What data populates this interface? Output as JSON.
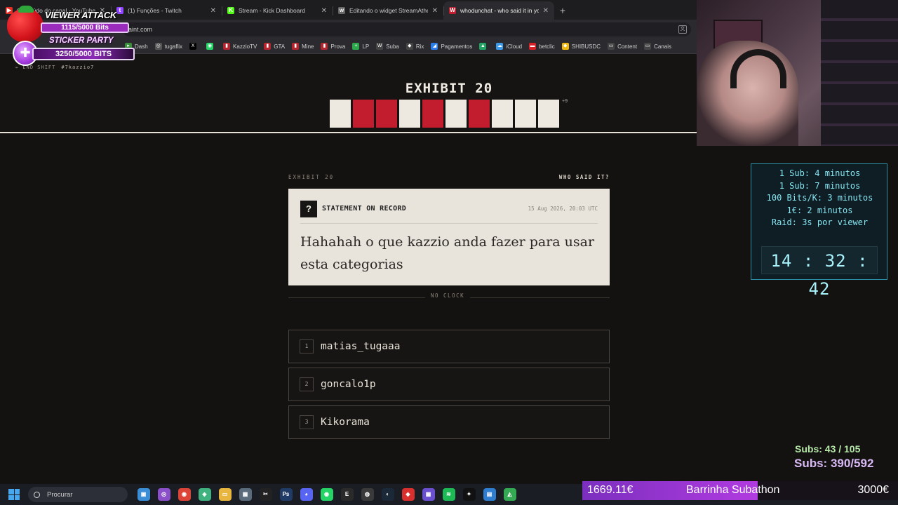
{
  "browser": {
    "tabs": [
      {
        "title": "Conteúdo do canal - YouTube Studio",
        "fav": "#e52d27",
        "glyph": "▶",
        "active": false
      },
      {
        "title": "(1) Funções - Twitch",
        "fav": "#9146ff",
        "glyph": "t",
        "active": false
      },
      {
        "title": "Stream - Kick Dashboard",
        "fav": "#53fc18",
        "glyph": "K",
        "active": false
      },
      {
        "title": "Editando o widget StreamAthon",
        "fav": "#666666",
        "glyph": "w",
        "active": false
      },
      {
        "title": "whodunchat - who said it in your chat",
        "fav": "#c21d2e",
        "glyph": "W",
        "active": true
      }
    ],
    "new_tab": "+",
    "address": "aint.com",
    "bookmarks": [
      {
        "label": "Dash",
        "color": "#3a8f3a",
        "glyph": "▸"
      },
      {
        "label": "tugaflix",
        "color": "#555555",
        "glyph": "◎"
      },
      {
        "label": "",
        "color": "#000000",
        "glyph": "X"
      },
      {
        "label": "",
        "color": "#25d366",
        "glyph": "◉"
      },
      {
        "label": "KazzioTV",
        "color": "#b3262e",
        "glyph": "▮"
      },
      {
        "label": "GTA",
        "color": "#b3262e",
        "glyph": "▮"
      },
      {
        "label": "Mine",
        "color": "#b3262e",
        "glyph": "▮"
      },
      {
        "label": "Prova",
        "color": "#b3262e",
        "glyph": "▮"
      },
      {
        "label": "LP",
        "color": "#2da84a",
        "glyph": "+"
      },
      {
        "label": "Suba",
        "color": "#444444",
        "glyph": "W"
      },
      {
        "label": "Rix",
        "color": "#444444",
        "glyph": "◆"
      },
      {
        "label": "Pagamentos",
        "color": "#2b7de9",
        "glyph": "◢"
      },
      {
        "label": "",
        "color": "#1fa463",
        "glyph": "▲"
      },
      {
        "label": "iCloud",
        "color": "#3b9be8",
        "glyph": "☁"
      },
      {
        "label": "betclic",
        "color": "#d71f26",
        "glyph": "▬"
      },
      {
        "label": "SHIBUSDC",
        "color": "#f0b90b",
        "glyph": "◆"
      },
      {
        "label": "Content",
        "color": "#444444",
        "glyph": "▭"
      },
      {
        "label": "Canais",
        "color": "#444444",
        "glyph": "▭"
      }
    ]
  },
  "page": {
    "end_shift": "← END SHIFT",
    "channel": "#7kazzio7",
    "exhibit_title": "EXHIBIT 20",
    "strip": [
      "white",
      "red",
      "red",
      "white",
      "red",
      "white",
      "red",
      "white",
      "white",
      "white"
    ],
    "strip_more": "+9",
    "label_left": "EXHIBIT 20",
    "label_right": "WHO SAID IT?",
    "statement_label": "STATEMENT ON RECORD",
    "statement_time": "15 Aug 2026, 20:03 UTC",
    "quote": "Hahahah o que kazzio anda fazer para usar esta categorias",
    "no_clock": "NO CLOCK",
    "options": [
      {
        "num": "1",
        "name": "matias_tugaaa"
      },
      {
        "num": "2",
        "name": "goncalo1p"
      },
      {
        "num": "3",
        "name": "Kikorama"
      }
    ]
  },
  "overlay": {
    "viewer_attack": "VIEWER ATTACK",
    "bits1": "1115/5000 Bits",
    "sticker_party": "STICKER PARTY",
    "bits2": "3250/5000 BITS",
    "timer_rules": [
      "1 Sub: 4 minutos",
      "1 Sub: 7 minutos",
      "100 Bits/K: 3 minutos",
      "1€: 2 minutos",
      "Raid: 3s por viewer"
    ],
    "clock": "14 : 32 : 42",
    "subs_a": "Subs: 43 / 105",
    "subs_b": "Subs: 390/592",
    "subathon_left": "1669.11€",
    "subathon_mid": "Barrinha Subathon",
    "subathon_right": "3000€",
    "subathon_progress": 0.556
  },
  "taskbar": {
    "search_placeholder": "Procurar",
    "apps": [
      {
        "name": "photos-icon",
        "color": "#3b8ed6",
        "glyph": "▣"
      },
      {
        "name": "camera-icon",
        "color": "#8a4fc9",
        "glyph": "◎"
      },
      {
        "name": "chrome-icon",
        "color": "#db4437",
        "glyph": "◉"
      },
      {
        "name": "app-icon",
        "color": "#3fb27f",
        "glyph": "◈"
      },
      {
        "name": "folder-icon",
        "color": "#e8b53e",
        "glyph": "▭"
      },
      {
        "name": "calculator-icon",
        "color": "#5a6b7c",
        "glyph": "▦"
      },
      {
        "name": "capcut-icon",
        "color": "#222222",
        "glyph": "✂"
      },
      {
        "name": "photoshop-icon",
        "color": "#1f3b66",
        "glyph": "Ps"
      },
      {
        "name": "discord-icon",
        "color": "#5865f2",
        "glyph": "◕"
      },
      {
        "name": "whatsapp-icon",
        "color": "#25d366",
        "glyph": "◉"
      },
      {
        "name": "epic-icon",
        "color": "#2a2a2a",
        "glyph": "E"
      },
      {
        "name": "obs-icon",
        "color": "#3a3a3a",
        "glyph": "◍"
      },
      {
        "name": "steam-icon",
        "color": "#1b2838",
        "glyph": "◐"
      },
      {
        "name": "app2-icon",
        "color": "#d9302f",
        "glyph": "◆"
      },
      {
        "name": "grid-icon",
        "color": "#6a4fd1",
        "glyph": "▦"
      },
      {
        "name": "spotify-icon",
        "color": "#1db954",
        "glyph": "≋"
      },
      {
        "name": "capcut2-icon",
        "color": "#111111",
        "glyph": "✦"
      },
      {
        "name": "notes-icon",
        "color": "#2f7dd1",
        "glyph": "▤"
      },
      {
        "name": "drive-icon",
        "color": "#34a853",
        "glyph": "◭"
      }
    ]
  }
}
